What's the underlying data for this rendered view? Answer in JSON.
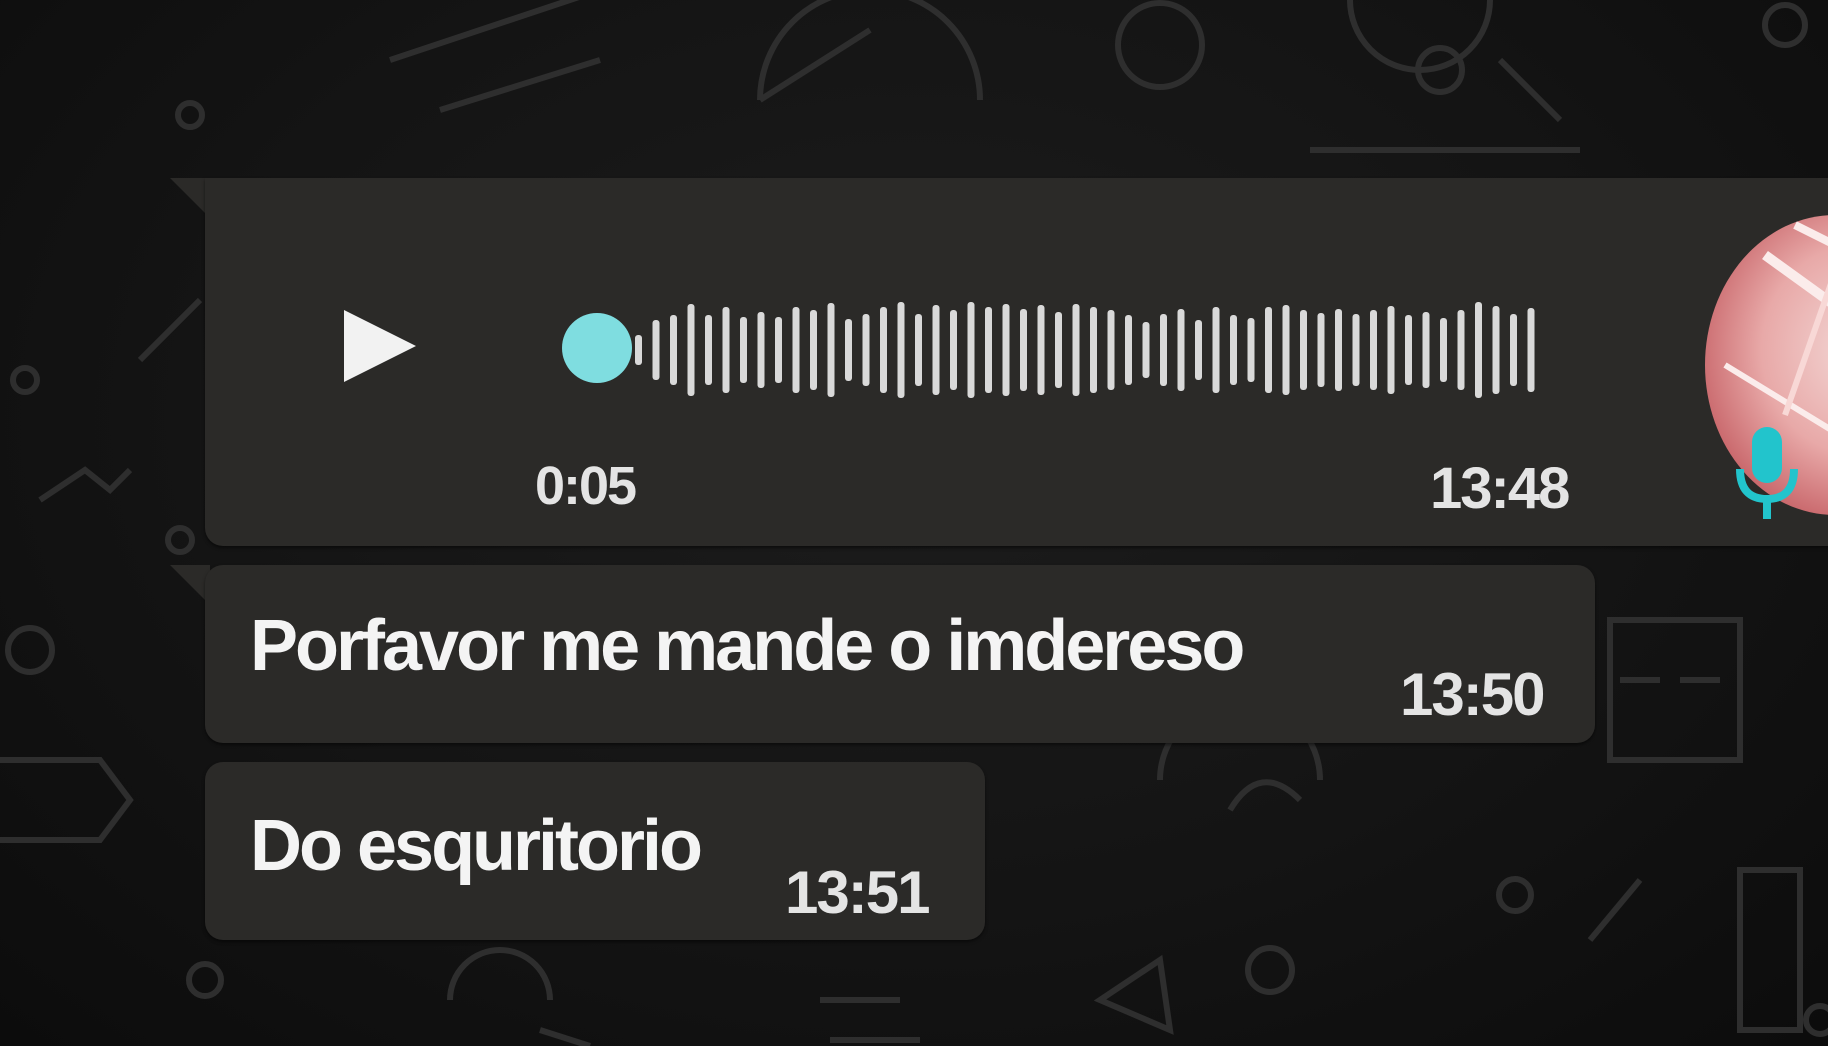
{
  "voice_message": {
    "duration": "0:05",
    "time": "13:48",
    "progress": 0,
    "play_icon": "play-icon",
    "status_icon": "microphone-icon",
    "accent_color": "#7fdde0"
  },
  "messages": [
    {
      "text": "Porfavor me mande o imdereso",
      "time": "13:50"
    },
    {
      "text": "Do esquritorio",
      "time": "13:51"
    }
  ],
  "colors": {
    "background": "#141414",
    "bubble": "#2b2a28",
    "text": "#f4f4f4"
  }
}
